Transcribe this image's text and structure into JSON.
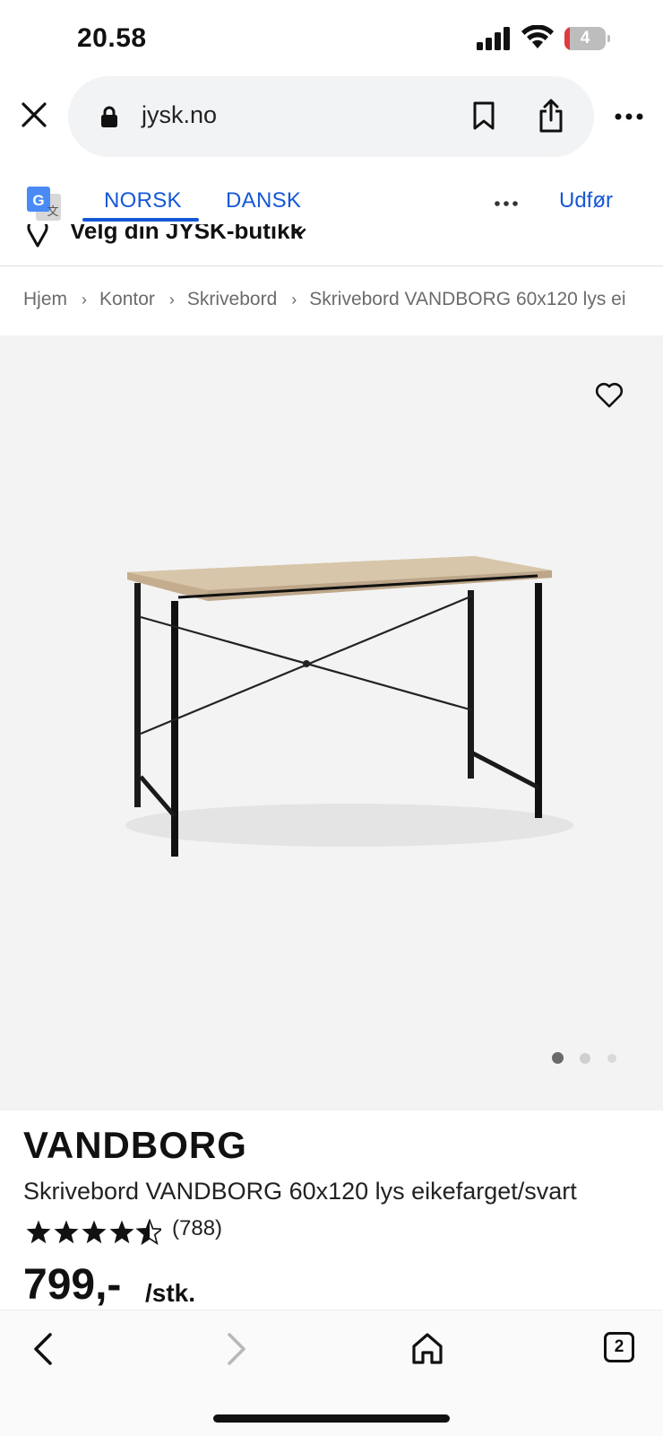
{
  "status_bar": {
    "time": "20.58",
    "battery_level": "4"
  },
  "browser": {
    "url": "jysk.no",
    "tab_count": "2"
  },
  "translate_bar": {
    "tab_norsk": "NORSK",
    "tab_dansk": "DANSK",
    "action": "Udfør",
    "active_tab": "NORSK"
  },
  "store_picker": {
    "label": "Velg din JYSK-butikk"
  },
  "breadcrumb": [
    "Hjem",
    "Kontor",
    "Skrivebord",
    "Skrivebord VANDBORG 60x120 lys ei"
  ],
  "gallery": {
    "image_count": 3,
    "active_index": 0
  },
  "product": {
    "brand": "VANDBORG",
    "name": "Skrivebord VANDBORG 60x120 lys eikefarget/svart",
    "rating": 4.5,
    "reviews": "(788)",
    "price": "799,-",
    "unit": "/stk."
  },
  "colors": {
    "link_blue": "#1558d6",
    "gallery_bg": "#f3f3f3"
  }
}
